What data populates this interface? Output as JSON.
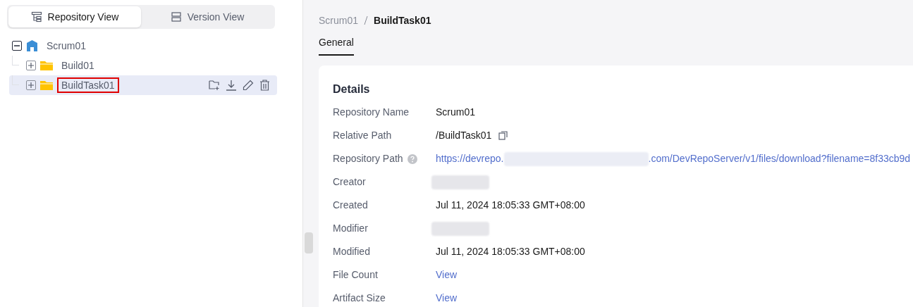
{
  "view_switch": [
    {
      "label": "Repository View",
      "selected": true
    },
    {
      "label": "Version View",
      "selected": false
    }
  ],
  "tree": [
    {
      "label": "Scrum01",
      "kind": "repo",
      "expanded": true,
      "selected": false,
      "outlined": false,
      "children": [
        {
          "label": "Build01",
          "kind": "folder",
          "expanded": false,
          "selected": false,
          "outlined": false
        },
        {
          "label": "BuildTask01",
          "kind": "folder",
          "expanded": false,
          "selected": true,
          "outlined": true
        }
      ]
    }
  ],
  "breadcrumb": [
    "Scrum01",
    "BuildTask01"
  ],
  "tabs": [
    {
      "label": "General",
      "selected": true
    }
  ],
  "details": {
    "title": "Details",
    "rows": [
      {
        "label": "Repository Name",
        "kind": "text",
        "value": "Scrum01"
      },
      {
        "label": "Relative Path",
        "kind": "copy",
        "value": "/BuildTask01"
      },
      {
        "label": "Repository Path",
        "kind": "link-redacted",
        "help": true,
        "value": "https://devrepo.",
        "value_end": ".com/DevRepoServer/v1/files/download?filename=8f33cb9d"
      },
      {
        "label": "Creator",
        "kind": "redacted"
      },
      {
        "label": "Created",
        "kind": "text",
        "value": "Jul 11, 2024 18:05:33 GMT+08:00"
      },
      {
        "label": "Modifier",
        "kind": "redacted"
      },
      {
        "label": "Modified",
        "kind": "text",
        "value": "Jul 11, 2024 18:05:33 GMT+08:00"
      },
      {
        "label": "File Count",
        "kind": "link",
        "value": "View"
      },
      {
        "label": "Artifact Size",
        "kind": "link",
        "value": "View"
      }
    ]
  }
}
